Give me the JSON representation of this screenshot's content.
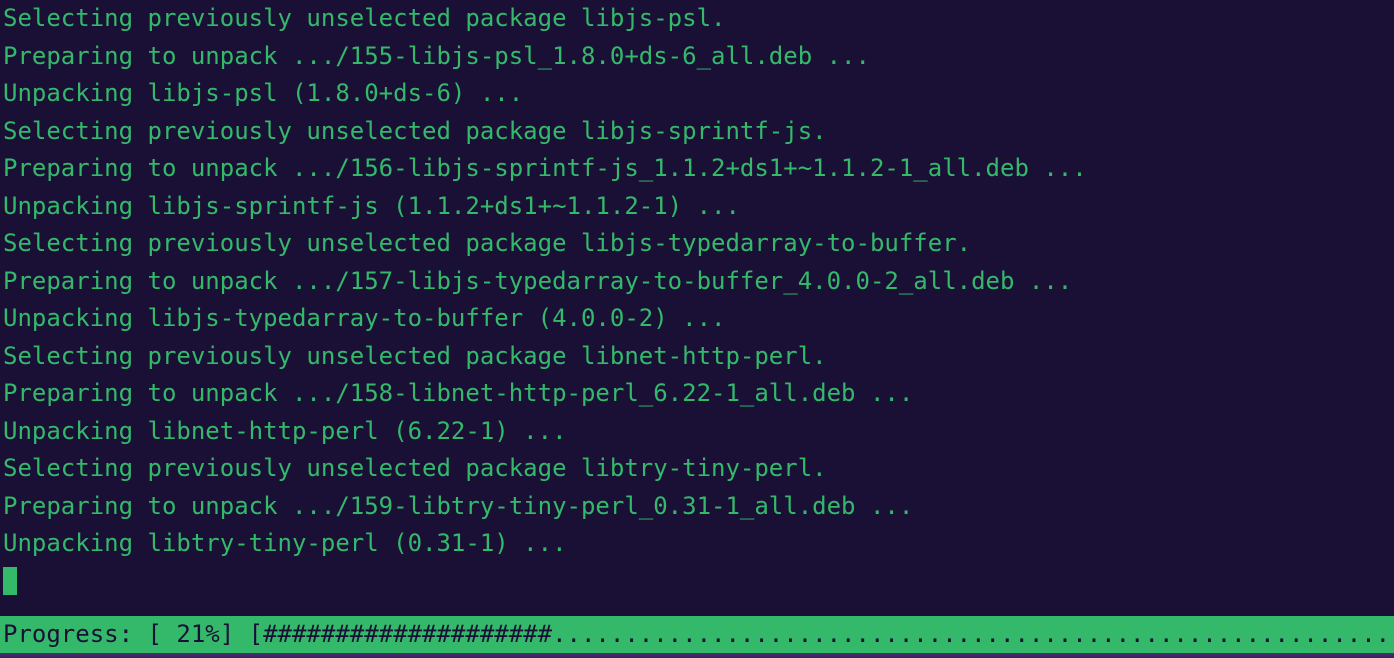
{
  "terminal": {
    "lines": [
      "Selecting previously unselected package libjs-psl.",
      "Preparing to unpack .../155-libjs-psl_1.8.0+ds-6_all.deb ...",
      "Unpacking libjs-psl (1.8.0+ds-6) ...",
      "Selecting previously unselected package libjs-sprintf-js.",
      "Preparing to unpack .../156-libjs-sprintf-js_1.1.2+ds1+~1.1.2-1_all.deb ...",
      "Unpacking libjs-sprintf-js (1.1.2+ds1+~1.1.2-1) ...",
      "Selecting previously unselected package libjs-typedarray-to-buffer.",
      "Preparing to unpack .../157-libjs-typedarray-to-buffer_4.0.0-2_all.deb ...",
      "Unpacking libjs-typedarray-to-buffer (4.0.0-2) ...",
      "Selecting previously unselected package libnet-http-perl.",
      "Preparing to unpack .../158-libnet-http-perl_6.22-1_all.deb ...",
      "Unpacking libnet-http-perl (6.22-1) ...",
      "Selecting previously unselected package libtry-tiny-perl.",
      "Preparing to unpack .../159-libtry-tiny-perl_0.31-1_all.deb ...",
      "Unpacking libtry-tiny-perl (0.31-1) ..."
    ],
    "progress_label": "Progress:",
    "progress_percent": 21,
    "progress_text": "Progress: [ 21%] [####################.........................................................."
  }
}
